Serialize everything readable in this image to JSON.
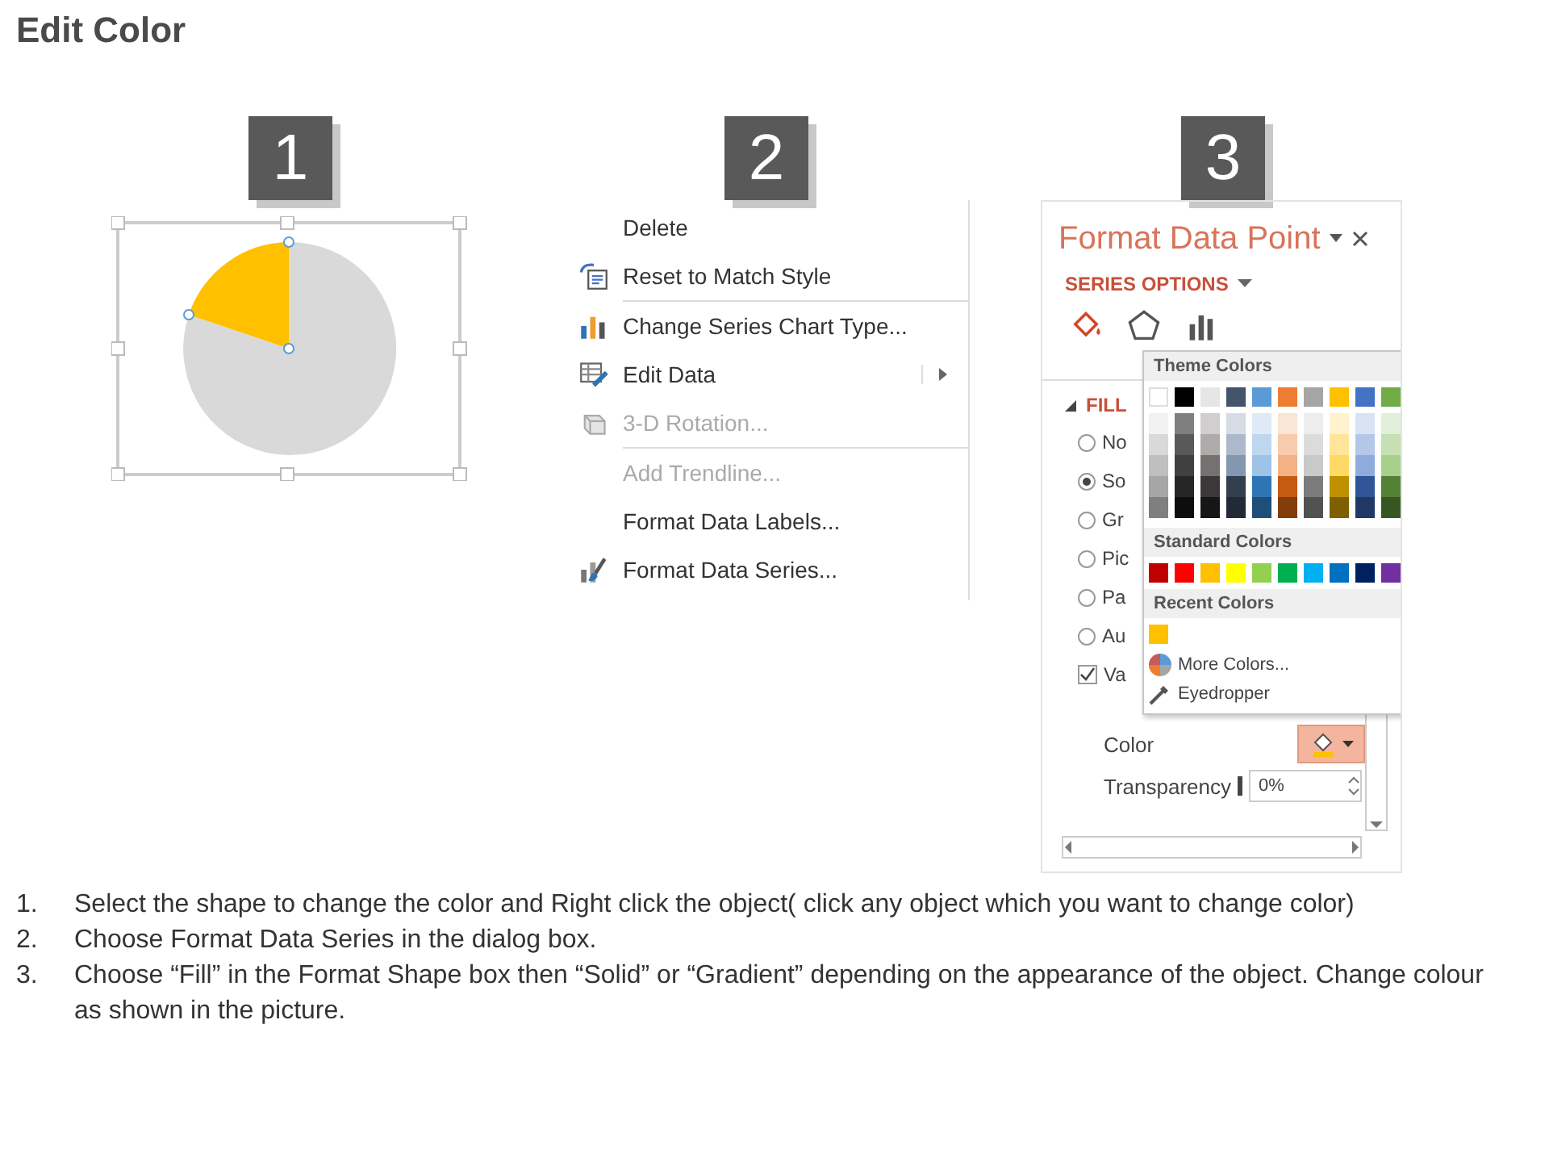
{
  "title": "Edit Color",
  "panel_1": {
    "badge": "1"
  },
  "panel_2": {
    "badge": "2",
    "menu": [
      {
        "label": "Delete",
        "disabled": false,
        "separator": false,
        "submenu": false
      },
      {
        "label": "Reset to Match Style",
        "disabled": false,
        "separator": false,
        "submenu": false
      },
      {
        "label": "Change Series Chart Type...",
        "disabled": false,
        "separator": true,
        "submenu": false
      },
      {
        "label": "Edit Data",
        "disabled": false,
        "separator": false,
        "submenu": true
      },
      {
        "label": "3-D Rotation...",
        "disabled": true,
        "separator": false,
        "submenu": false
      },
      {
        "label": "Add Trendline...",
        "disabled": true,
        "separator": true,
        "submenu": false
      },
      {
        "label": "Format Data Labels...",
        "disabled": false,
        "separator": false,
        "submenu": false
      },
      {
        "label": "Format Data Series...",
        "disabled": false,
        "separator": false,
        "submenu": false
      }
    ]
  },
  "panel_3": {
    "badge": "3",
    "pane": {
      "title": "Format Data Point",
      "section": "SERIES OPTIONS",
      "tabs": [
        {
          "selected": true
        },
        {
          "selected": false
        },
        {
          "selected": false
        }
      ],
      "fill_heading": "FILL",
      "options": [
        {
          "kind": "radio",
          "label": "No",
          "selected": false
        },
        {
          "kind": "radio",
          "label": "So",
          "selected": true
        },
        {
          "kind": "radio",
          "label": "Gr",
          "selected": false
        },
        {
          "kind": "radio",
          "label": "Pic",
          "selected": false
        },
        {
          "kind": "radio",
          "label": "Pa",
          "selected": false
        },
        {
          "kind": "radio",
          "label": "Au",
          "selected": false
        },
        {
          "kind": "checkbox",
          "label": "Va",
          "checked": true
        }
      ],
      "color_label": "Color",
      "transparency": {
        "label": "Transparency",
        "value": "0%"
      },
      "palette": {
        "theme_heading": "Theme Colors",
        "theme_columns": [
          {
            "shades": [
              {
                "color": "#ffffff"
              },
              {
                "color": "#f2f2f2"
              },
              {
                "color": "#d9d9d9"
              },
              {
                "color": "#bfbfbf"
              },
              {
                "color": "#a6a6a6"
              },
              {
                "color": "#7f7f7f"
              }
            ]
          },
          {
            "shades": [
              {
                "color": "#000000"
              },
              {
                "color": "#7f7f7f"
              },
              {
                "color": "#595959"
              },
              {
                "color": "#404040"
              },
              {
                "color": "#262626"
              },
              {
                "color": "#0d0d0d"
              }
            ]
          },
          {
            "shades": [
              {
                "color": "#e7e6e6"
              },
              {
                "color": "#d0cece"
              },
              {
                "color": "#aeabab"
              },
              {
                "color": "#757171"
              },
              {
                "color": "#3a3838"
              },
              {
                "color": "#171616"
              }
            ]
          },
          {
            "shades": [
              {
                "color": "#44546a"
              },
              {
                "color": "#d6dce4"
              },
              {
                "color": "#adb9ca"
              },
              {
                "color": "#8497b0"
              },
              {
                "color": "#333f4f"
              },
              {
                "color": "#222a35"
              }
            ]
          },
          {
            "shades": [
              {
                "color": "#5b9bd5"
              },
              {
                "color": "#deebf6"
              },
              {
                "color": "#bdd7ee"
              },
              {
                "color": "#9dc3e6"
              },
              {
                "color": "#2e75b5"
              },
              {
                "color": "#1f4e79"
              }
            ]
          },
          {
            "shades": [
              {
                "color": "#ed7d31"
              },
              {
                "color": "#fbe5d5"
              },
              {
                "color": "#f7cbac"
              },
              {
                "color": "#f4b183"
              },
              {
                "color": "#c55a11"
              },
              {
                "color": "#843c0b"
              }
            ]
          },
          {
            "shades": [
              {
                "color": "#a5a5a5"
              },
              {
                "color": "#ededed"
              },
              {
                "color": "#dbdbdb"
              },
              {
                "color": "#c9c9c9"
              },
              {
                "color": "#7b7b7b"
              },
              {
                "color": "#525252"
              }
            ]
          },
          {
            "shades": [
              {
                "color": "#ffc000"
              },
              {
                "color": "#fff2cc"
              },
              {
                "color": "#fee599"
              },
              {
                "color": "#ffd965"
              },
              {
                "color": "#bf9000"
              },
              {
                "color": "#7f6000"
              }
            ]
          },
          {
            "shades": [
              {
                "color": "#4472c4"
              },
              {
                "color": "#dae3f3"
              },
              {
                "color": "#b4c7e7"
              },
              {
                "color": "#8faadc"
              },
              {
                "color": "#2f5597"
              },
              {
                "color": "#203864"
              }
            ]
          },
          {
            "shades": [
              {
                "color": "#70ad47"
              },
              {
                "color": "#e2efd9"
              },
              {
                "color": "#c5e0b3"
              },
              {
                "color": "#a8d08d"
              },
              {
                "color": "#538135"
              },
              {
                "color": "#375623"
              }
            ]
          }
        ],
        "standard_heading": "Standard Colors",
        "standard": [
          {
            "color": "#c00000"
          },
          {
            "color": "#ff0000"
          },
          {
            "color": "#ffc000"
          },
          {
            "color": "#ffff00"
          },
          {
            "color": "#92d050"
          },
          {
            "color": "#00b050"
          },
          {
            "color": "#00b0f0"
          },
          {
            "color": "#0070c0"
          },
          {
            "color": "#002060"
          },
          {
            "color": "#7030a0"
          }
        ],
        "recent_heading": "Recent Colors",
        "recent": [
          {
            "color": "#ffc000"
          }
        ],
        "more_colors": "More Colors...",
        "eyedropper": "Eyedropper"
      }
    }
  },
  "instructions": [
    {
      "number": "1.",
      "text": "Select the shape to change the color and Right click the object( click any object which you want to change color)"
    },
    {
      "number": "2.",
      "text": "Choose Format Data Series in the dialog box."
    },
    {
      "number": "3.",
      "text": "Choose “Fill” in the Format Shape box then “Solid” or “Gradient” depending on the appearance of the object. Change colour as shown in the picture."
    }
  ]
}
